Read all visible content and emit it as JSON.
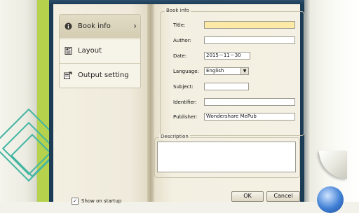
{
  "nav": {
    "items": [
      {
        "label": "Book info",
        "icon": "info-icon"
      },
      {
        "label": "Layout",
        "icon": "layout-icon"
      },
      {
        "label": "Output setting",
        "icon": "output-setting-icon"
      }
    ]
  },
  "startup": {
    "label": "Show on startup",
    "checked": true
  },
  "book_info": {
    "title": "Book info",
    "fields": {
      "title": {
        "label": "Title:",
        "value": ""
      },
      "author": {
        "label": "Author:",
        "value": ""
      },
      "date": {
        "label": "Date:",
        "value": "2015－11－30"
      },
      "language": {
        "label": "Language:",
        "value": "English"
      },
      "subject": {
        "label": "Subject:",
        "value": ""
      },
      "identifier": {
        "label": "Identifier:",
        "value": ""
      },
      "publisher": {
        "label": "Publisher:",
        "value": "Wondershare MePub"
      }
    }
  },
  "description": {
    "title": "Description",
    "value": ""
  },
  "buttons": {
    "ok": "OK",
    "cancel": "Cancel"
  },
  "colors": {
    "accent_green": "#b6d24c",
    "frame": "#1c3c56",
    "title_highlight": "#fbe9a5"
  }
}
